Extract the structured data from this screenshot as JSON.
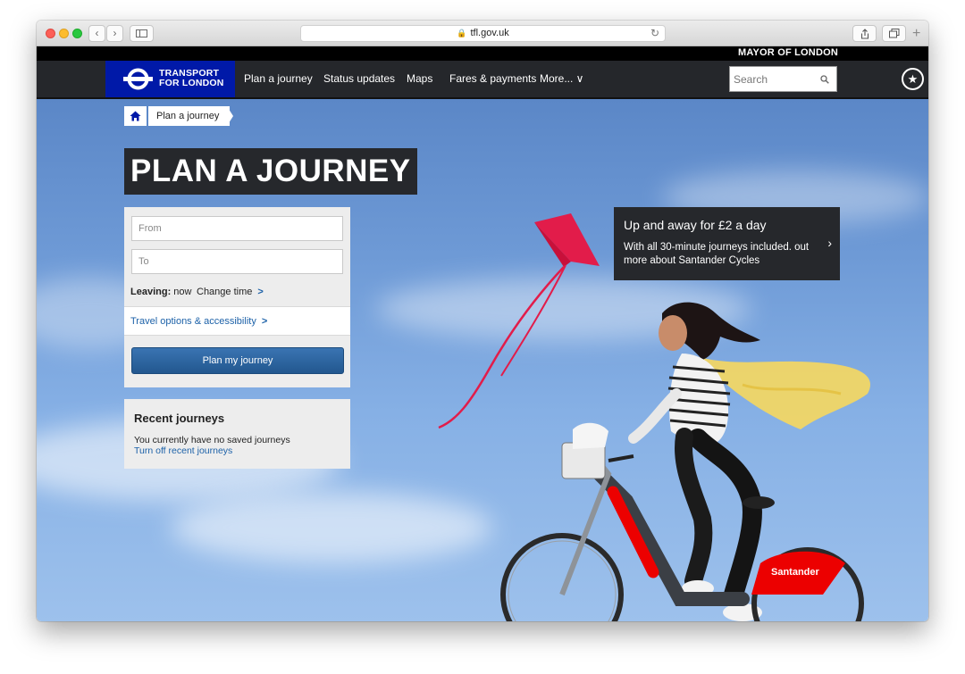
{
  "browser": {
    "url": "tfl.gov.uk",
    "back_icon": "chevron-left-icon",
    "forward_icon": "chevron-right-icon"
  },
  "header": {
    "mayor": "MAYOR OF LONDON",
    "logo_line1": "TRANSPORT",
    "logo_line2": "FOR LONDON",
    "nav": [
      "Plan a journey",
      "Status updates",
      "Maps",
      "Fares & payments",
      "More... ∨"
    ],
    "search_placeholder": "Search"
  },
  "breadcrumb": {
    "current": "Plan a journey"
  },
  "page_title": "PLAN A JOURNEY",
  "journey_form": {
    "from_placeholder": "From",
    "to_placeholder": "To",
    "leaving_label": "Leaving:",
    "leaving_value": "now",
    "change_time": "Change time",
    "travel_options": "Travel options & accessibility",
    "submit": "Plan my journey"
  },
  "recent": {
    "title": "Recent journeys",
    "empty_text": "You currently have no saved journeys",
    "toggle_link": "Turn off recent journeys"
  },
  "promo": {
    "title": "Up and away for £2 a day",
    "body": "With all 30-minute journeys included. out more about Santander Cycles"
  },
  "bike_brand": "Santander",
  "colors": {
    "tfl_blue": "#0019a8",
    "nav_dark": "#25272b",
    "link_blue": "#1c61a8",
    "kite_red": "#e21c4a",
    "santander_red": "#ec0000"
  }
}
